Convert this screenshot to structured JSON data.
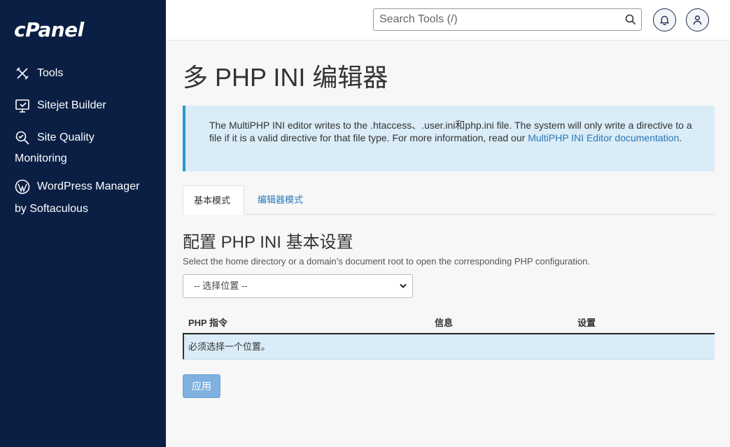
{
  "sidebar": {
    "logo": "cPanel",
    "items": [
      {
        "label": "Tools",
        "icon": "tools-icon"
      },
      {
        "label": "Sitejet Builder",
        "icon": "sitejet-icon"
      },
      {
        "label": "Site Quality",
        "label2": "Monitoring",
        "icon": "site-quality-icon"
      },
      {
        "label": "WordPress Manager",
        "label2": "by Softaculous",
        "icon": "wordpress-icon"
      }
    ]
  },
  "topbar": {
    "search_placeholder": "Search Tools (/)",
    "icons": [
      "search-icon",
      "bell-icon",
      "user-icon"
    ]
  },
  "main": {
    "title": "多 PHP INI 编辑器",
    "alert": {
      "text": "The MultiPHP INI editor writes to the .htaccess、.user.ini和php.ini file. The system will only write a directive to a file if it is a valid directive for that file type. For more information, read our ",
      "link": "MultiPHP INI Editor documentation",
      "end": "."
    },
    "tabs": [
      {
        "label": "基本模式",
        "active": true
      },
      {
        "label": "编辑器模式",
        "active": false
      }
    ],
    "section_title": "配置 PHP INI 基本设置",
    "help_text": "Select the home directory or a domain’s document root to open the corresponding PHP configuration.",
    "select_value": "-- 选择位置 --",
    "table": {
      "columns": [
        "PHP 指令",
        "信息",
        "设置"
      ],
      "empty_message": "必须选择一个位置。"
    },
    "apply_label": "应用"
  },
  "colors": {
    "sidebar_bg": "#0b1f45",
    "alert_bg": "#d9ecf7",
    "alert_border": "#2a98c9",
    "link": "#2a79b8",
    "apply_bg": "#7eb1e0"
  }
}
